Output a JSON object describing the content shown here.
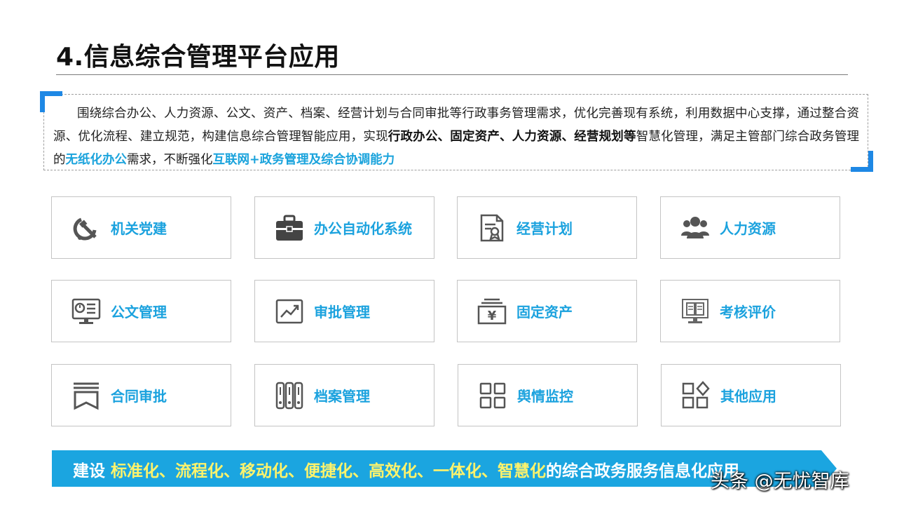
{
  "title": "4.信息综合管理平台应用",
  "intro": {
    "p1": "围绕综合办公、人力资源、公文、资产、档案、经营计划与合同审批等行政事务管理需求，优化完善现有系统，利用数据中心支撑，通过整合资源、优化流程、建立规范，构建信息综合管理智能应用，实现",
    "b1": "行政办公、固定资产、人力资源、经营规划等",
    "p2": "智慧化管理，满足主管部门综合政务管理的",
    "h1": "无纸化办公",
    "p3": "需求，不断强化",
    "h2": "互联网+政务管理及综合协调能力"
  },
  "modules": [
    {
      "label": "机关党建",
      "icon": "hammer-sickle-icon"
    },
    {
      "label": "办公自动化系统",
      "icon": "briefcase-icon"
    },
    {
      "label": "经营计划",
      "icon": "certificate-document-icon"
    },
    {
      "label": "人力资源",
      "icon": "people-group-icon"
    },
    {
      "label": "公文管理",
      "icon": "monitor-document-icon"
    },
    {
      "label": "审批管理",
      "icon": "trend-chart-icon"
    },
    {
      "label": "固定资产",
      "icon": "yen-asset-icon"
    },
    {
      "label": "考核评价",
      "icon": "book-screen-icon"
    },
    {
      "label": "合同审批",
      "icon": "bookmark-icon"
    },
    {
      "label": "档案管理",
      "icon": "archive-binders-icon"
    },
    {
      "label": "舆情监控",
      "icon": "grid-squares-icon"
    },
    {
      "label": "其他应用",
      "icon": "shapes-apps-icon"
    }
  ],
  "banner": {
    "lead": "建设 ",
    "keywords": "标准化、流程化、移动化、便捷化、高效化、一体化、智慧化",
    "tail": "的综合政务服务信息化应用"
  },
  "watermark": "头条 @无忧智库",
  "colors": {
    "accent": "#1ba2de",
    "corner_blue": "#1e88e5",
    "banner_bg": "#1ba5e0",
    "banner_keyword": "#fff36b",
    "icon_gray": "#555555"
  }
}
